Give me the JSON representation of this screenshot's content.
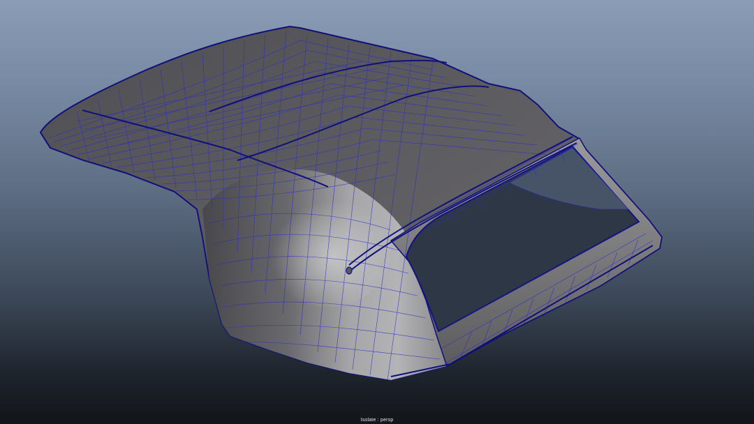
{
  "viewport": {
    "camera_label": "Isolate : persp",
    "colors": {
      "background_top": "#8b9db6",
      "background_bottom": "#121519",
      "shaded_surface": "#5b5a5c",
      "surface_highlight": "#bdbdbf",
      "wireframe": "#2a2cc8",
      "panel_edges": "#10107a"
    }
  }
}
